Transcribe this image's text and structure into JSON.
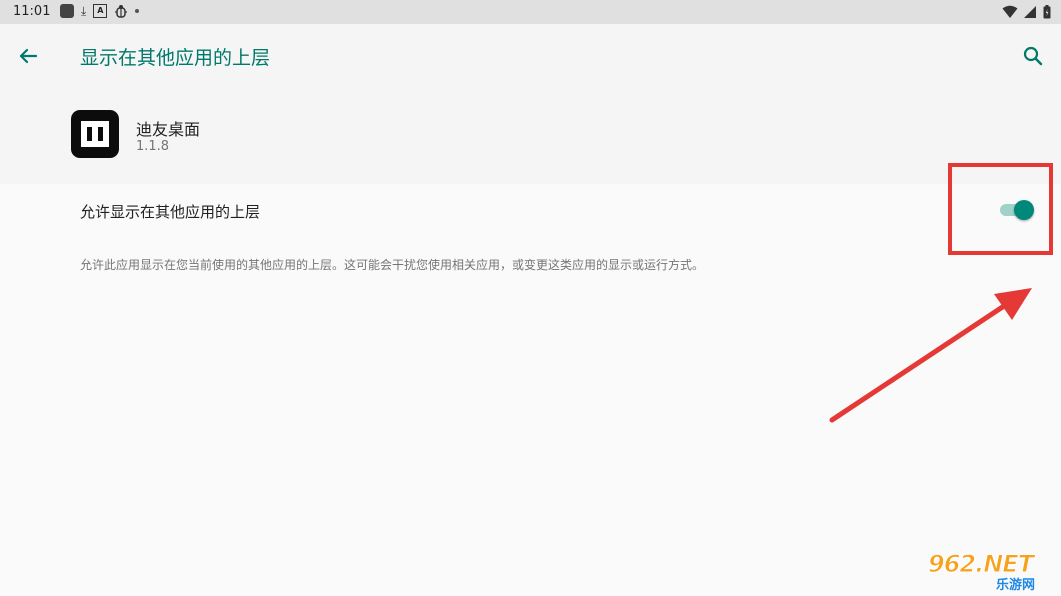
{
  "status_bar": {
    "time": "11:01",
    "left_icons": [
      "app-icon",
      "download-icon",
      "text-icon",
      "bug-icon",
      "dot-icon"
    ],
    "right_icons": [
      "wifi-icon",
      "signal-icon",
      "battery-icon"
    ]
  },
  "appbar": {
    "title": "显示在其他应用的上层",
    "back_icon": "arrow-back-icon",
    "search_icon": "search-icon"
  },
  "app": {
    "name": "迪友桌面",
    "version": "1.1.8"
  },
  "permission": {
    "label": "允许显示在其他应用的上层",
    "enabled": true,
    "description": "允许此应用显示在您当前使用的其他应用的上层。这可能会干扰您使用相关应用，或变更这类应用的显示或运行方式。"
  },
  "watermark": {
    "main": "962.NET",
    "sub": "乐游网"
  },
  "colors": {
    "accent": "#00796b",
    "toggle_thumb": "#00897b",
    "toggle_track": "#9fd2c8",
    "highlight": "#e53935"
  }
}
